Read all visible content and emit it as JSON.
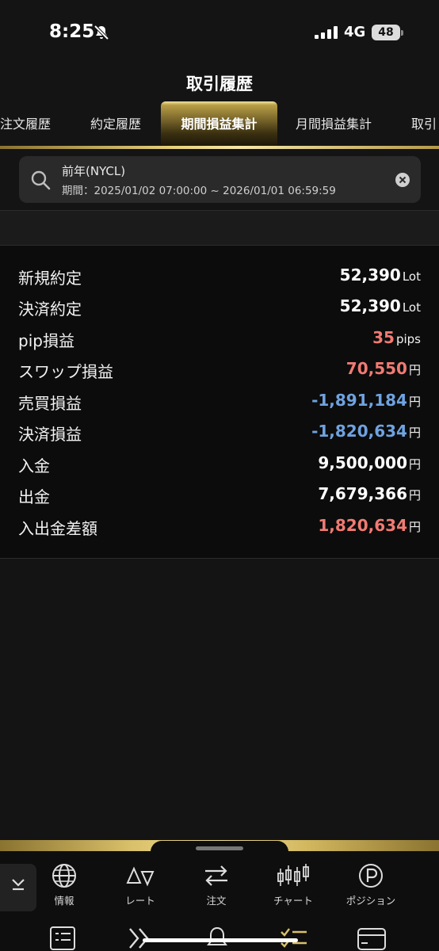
{
  "status_bar": {
    "time": "8:25",
    "network": "4G",
    "battery": "48"
  },
  "header": {
    "title": "取引履歴"
  },
  "tabs": [
    {
      "label": "注文履歴"
    },
    {
      "label": "約定履歴"
    },
    {
      "label": "期間損益集計",
      "active": true
    },
    {
      "label": "月間損益集計"
    },
    {
      "label": "取引"
    }
  ],
  "search": {
    "name": "前年(NYCL)",
    "period": "期間：2025/01/02 07:00:00 ~ 2026/01/01 06:59:59"
  },
  "summary": [
    {
      "label": "新規約定",
      "value": "52,390",
      "unit": "Lot",
      "tone": "plain"
    },
    {
      "label": "決済約定",
      "value": "52,390",
      "unit": "Lot",
      "tone": "plain"
    },
    {
      "label": "pip損益",
      "value": "35",
      "unit": "pips",
      "tone": "pos"
    },
    {
      "label": "スワップ損益",
      "value": "70,550",
      "unit": "円",
      "tone": "pos"
    },
    {
      "label": "売買損益",
      "value": "-1,891,184",
      "unit": "円",
      "tone": "neg"
    },
    {
      "label": "決済損益",
      "value": "-1,820,634",
      "unit": "円",
      "tone": "neg"
    },
    {
      "label": "入金",
      "value": "9,500,000",
      "unit": "円",
      "tone": "plain"
    },
    {
      "label": "出金",
      "value": "7,679,366",
      "unit": "円",
      "tone": "plain"
    },
    {
      "label": "入出金差額",
      "value": "1,820,634",
      "unit": "円",
      "tone": "pos"
    }
  ],
  "colors": {
    "positive": "#f07b73",
    "negative": "#6fa3e0",
    "accent": "#d9c06a"
  },
  "bottom_nav": [
    {
      "label": "情報",
      "icon": "globe-icon"
    },
    {
      "label": "レート",
      "icon": "rate-icon"
    },
    {
      "label": "注文",
      "icon": "exchange-icon"
    },
    {
      "label": "チャート",
      "icon": "candlestick-icon"
    },
    {
      "label": "ポジション",
      "icon": "position-icon"
    }
  ]
}
